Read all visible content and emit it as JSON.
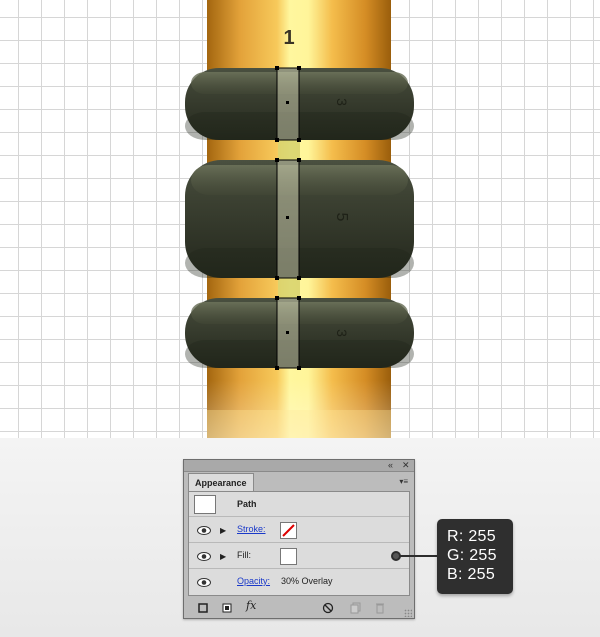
{
  "canvas": {
    "label_top": "1",
    "bands": [
      {
        "label": "3"
      },
      {
        "label": "5"
      },
      {
        "label": "3"
      }
    ],
    "colors": {
      "gold_dark": "#a56a12",
      "gold_mid": "#f0b54a",
      "gold_light": "#fff79a",
      "band_dark": "#2b2f23",
      "band_light": "#555b45"
    }
  },
  "appearance_panel": {
    "tab": "Appearance",
    "object_type": "Path",
    "stroke_label": "Stroke:",
    "fill_label": "Fill:",
    "opacity_label": "Opacity:",
    "opacity_value": "30% Overlay",
    "footer_fx": "fx"
  },
  "color_readout": {
    "r": "R: 255",
    "g": "G: 255",
    "b": "B: 255"
  }
}
